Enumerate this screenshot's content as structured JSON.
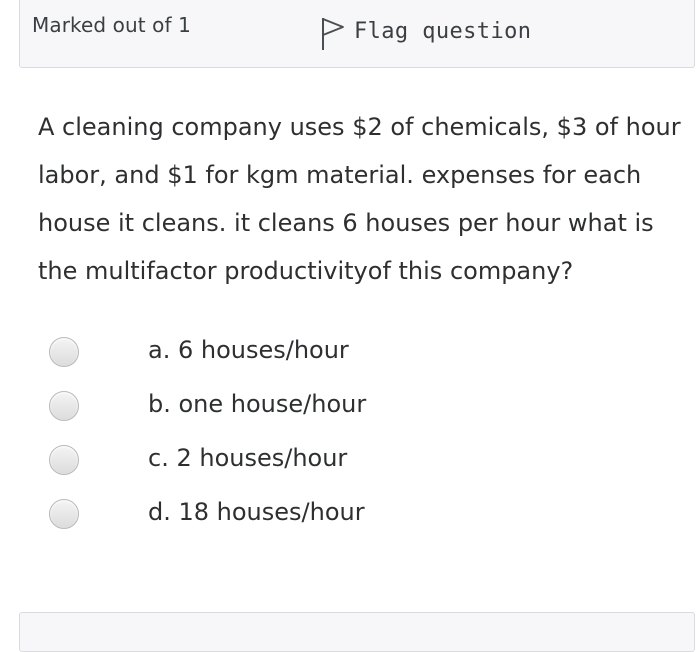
{
  "info": {
    "marked_out_of": "Marked out of 1",
    "flag_label": "Flag question"
  },
  "question": {
    "text": "A cleaning company uses $2 of chemicals, $3 of hour labor, and $1 for kgm material. expenses for each house it cleans. it cleans 6 houses per hour what is the multifactor productivityof this company?"
  },
  "answers": [
    {
      "label": "a. 6 houses/hour",
      "selected": false
    },
    {
      "label": "b. one house/hour",
      "selected": false
    },
    {
      "label": "c. 2 houses/hour",
      "selected": false
    },
    {
      "label": "d. 18 houses/hour",
      "selected": false
    }
  ],
  "icons": {
    "flag": "flag-icon",
    "radio": "radio-button"
  },
  "colors": {
    "info_background": "#f7f7f9",
    "info_border": "#d9dbde",
    "text": "#2d2f31"
  }
}
